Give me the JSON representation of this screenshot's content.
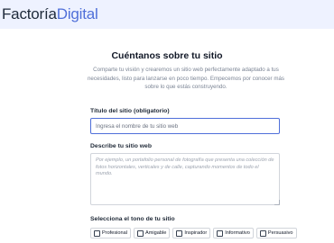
{
  "header": {
    "logo_brand": "Factoría",
    "logo_accent": "Digital"
  },
  "form": {
    "title": "Cuéntanos sobre tu sitio",
    "subtitle_lines": [
      "Comparte tu visión y crearemos un sitio web perfectamente adaptado a tus",
      "necesidades, listo para lanzarse en poco tiempo. Empecemos por conocer más",
      "sobre lo que estás construyendo."
    ],
    "site_title": {
      "label": "Título del sitio (obligatorio)",
      "placeholder": "Ingresa el nombre de tu sitio web",
      "value": ""
    },
    "site_description": {
      "label": "Describe tu sitio web",
      "placeholder": "Por ejemplo, un portafolio personal de fotografía que presenta una colección de fotos horizontales, verticales y de calle, capturando momentos de todo el mundo.",
      "value": ""
    },
    "tone": {
      "label": "Selecciona el tono de tu sitio",
      "options": [
        {
          "label": "Profesional",
          "checked": false
        },
        {
          "label": "Amigable",
          "checked": false
        },
        {
          "label": "Inspirador",
          "checked": false
        },
        {
          "label": "Informativo",
          "checked": false
        },
        {
          "label": "Persuasivo",
          "checked": false
        }
      ]
    }
  }
}
